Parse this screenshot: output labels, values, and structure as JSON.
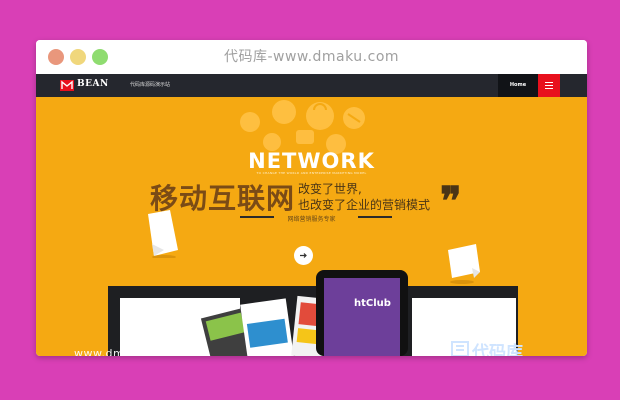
{
  "window": {
    "title": "代码库-www.dmaku.com"
  },
  "nav": {
    "logo_text": "BEAN",
    "tagline": "代码库源码演示站",
    "home_label": "Home"
  },
  "hero": {
    "headline": "NETWORK",
    "subline": "TO CHANGE THE WORLD AND ENTERPRISE MARKETING MODEL",
    "cn_big": "移动互联网",
    "cn_line1": "改变了世界,",
    "cn_line2": "也改变了企业的营销模式",
    "quote_mark": "❞",
    "tagline": "网络营销服务专家"
  },
  "showcase": {
    "phone_text": "htClub",
    "cn_watermark": "代码库",
    "site_watermark": "www.dmaku.com"
  },
  "colors": {
    "page_bg": "#d93fb6",
    "hero_bg": "#f5a912",
    "navbar_bg": "#25272e",
    "menu_accent": "#e8101d"
  }
}
